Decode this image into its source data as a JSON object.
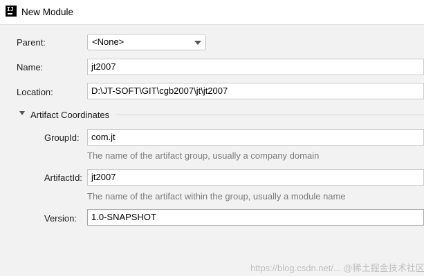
{
  "window": {
    "title": "New Module",
    "icon": "intellij-idea-icon",
    "icon_text": "IJ"
  },
  "form": {
    "parent_label": "Parent:",
    "parent_value": "<None>",
    "name_label": "Name:",
    "name_value": "jt2007",
    "location_label": "Location:",
    "location_value": "D:\\JT-SOFT\\GIT\\cgb2007\\jt\\jt2007"
  },
  "artifact": {
    "section_title": "Artifact Coordinates",
    "groupid_label": "GroupId:",
    "groupid_value": "com.jt",
    "groupid_hint": "The name of the artifact group, usually a company domain",
    "artifactid_label": "ArtifactId:",
    "artifactid_value": "jt2007",
    "artifactid_hint": "The name of the artifact within the group, usually a module name",
    "version_label": "Version:",
    "version_value": "1.0-SNAPSHOT"
  },
  "watermark": "https://blog.csdn.net/... @稀土掘金技术社区"
}
